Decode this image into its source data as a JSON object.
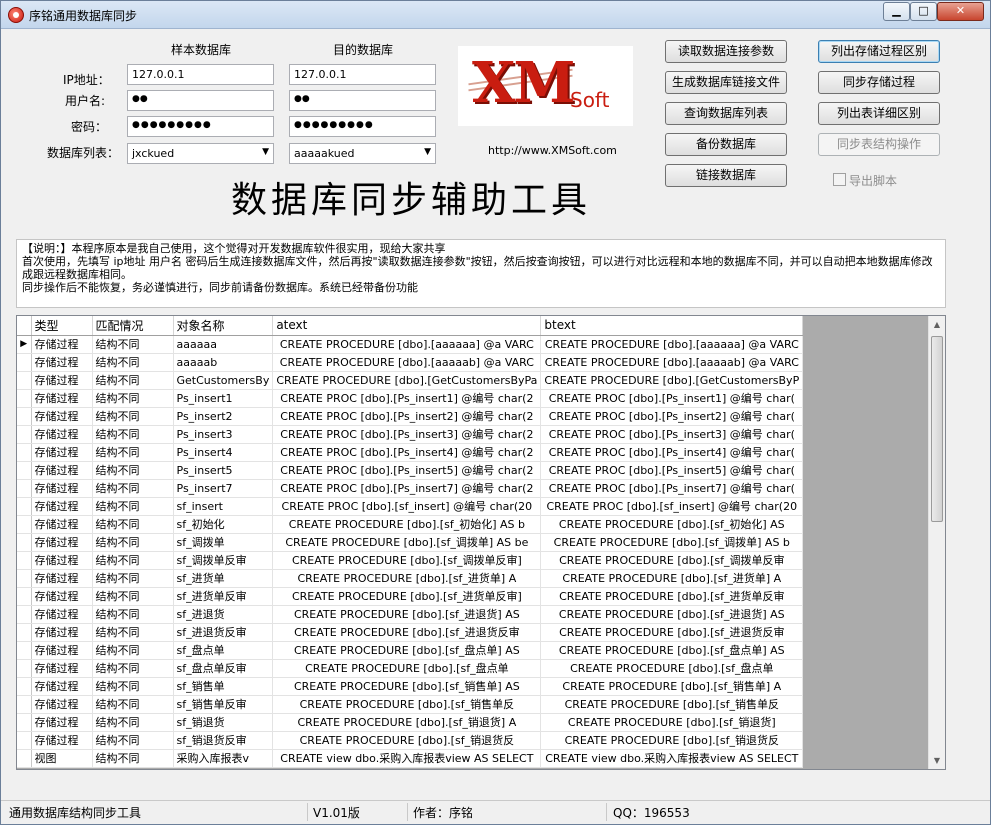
{
  "window": {
    "title": "序铭通用数据库同步"
  },
  "form": {
    "source_header": "样本数据库",
    "target_header": "目的数据库",
    "ip_label": "IP地址：",
    "user_label": "用户名:",
    "password_label": "密码：",
    "db_list_label": "数据库列表：",
    "source": {
      "ip": "127.0.0.1",
      "user": "●●",
      "password": "●●●●●●●●●",
      "database": "jxckued"
    },
    "target": {
      "ip": "127.0.0.1",
      "user": "●●",
      "password": "●●●●●●●●●",
      "database": "aaaaakued"
    }
  },
  "logo": {
    "brand": "XM",
    "suffix": "Soft",
    "url": "http://www.XMSoft.com"
  },
  "buttons": {
    "read_conn_params": "读取数据连接参数",
    "gen_conn_file": "生成数据库链接文件",
    "query_db_list": "查询数据库列表",
    "backup_db": "备份数据库",
    "connect_db": "链接数据库",
    "list_sp_diff": "列出存储过程区别",
    "sync_sp": "同步存储过程",
    "list_table_diff": "列出表详细区别",
    "sync_table_struct": "同步表结构操作",
    "export_script": "导出脚本"
  },
  "main_title": "数据库同步辅助工具",
  "description": {
    "line1": "【说明：】本程序原本是我自己使用，这个觉得对开发数据库软件很实用，现给大家共享",
    "line2": "首次使用，先填写 ip地址 用户名 密码后生成连接数据库文件，然后再按\"读取数据连接参数\"按钮，然后按查询按钮，可以进行对比远程和本地的数据库不同，并可以自动把本地数据库修改成跟远程数据库相同。",
    "line3": "同步操作后不能恢复，务必谨慎进行，同步前请备份数据库。系统已经带备份功能"
  },
  "grid": {
    "columns": [
      "类型",
      "匹配情况",
      "对象名称",
      "atext",
      "btext"
    ],
    "rows": [
      [
        "存储过程",
        "结构不同",
        "aaaaaa",
        "CREATE PROCEDURE  [dbo].[aaaaaa] @a VARC",
        "CREATE PROCEDURE  [dbo].[aaaaaa] @a VARC"
      ],
      [
        "存储过程",
        "结构不同",
        "aaaaab",
        "CREATE PROCEDURE  [dbo].[aaaaab] @a VARC",
        "CREATE PROCEDURE  [dbo].[aaaaab] @a VARC"
      ],
      [
        "存储过程",
        "结构不同",
        "GetCustomersBy",
        "CREATE PROCEDURE  [dbo].[GetCustomersByPa",
        "CREATE PROCEDURE  [dbo].[GetCustomersByP"
      ],
      [
        "存储过程",
        "结构不同",
        "Ps_insert1",
        "CREATE PROC [dbo].[Ps_insert1] @编号 char(2",
        "CREATE PROC [dbo].[Ps_insert1] @编号 char("
      ],
      [
        "存储过程",
        "结构不同",
        "Ps_insert2",
        "CREATE PROC [dbo].[Ps_insert2] @编号 char(2",
        "CREATE PROC [dbo].[Ps_insert2] @编号 char("
      ],
      [
        "存储过程",
        "结构不同",
        "Ps_insert3",
        "CREATE PROC [dbo].[Ps_insert3] @编号 char(2",
        "CREATE PROC [dbo].[Ps_insert3] @编号 char("
      ],
      [
        "存储过程",
        "结构不同",
        "Ps_insert4",
        "CREATE PROC [dbo].[Ps_insert4] @编号 char(2",
        "CREATE PROC [dbo].[Ps_insert4] @编号 char("
      ],
      [
        "存储过程",
        "结构不同",
        "Ps_insert5",
        "CREATE PROC [dbo].[Ps_insert5] @编号 char(2",
        "CREATE PROC [dbo].[Ps_insert5] @编号 char("
      ],
      [
        "存储过程",
        "结构不同",
        "Ps_insert7",
        "CREATE PROC [dbo].[Ps_insert7] @编号 char(2",
        "CREATE PROC [dbo].[Ps_insert7] @编号 char("
      ],
      [
        "存储过程",
        "结构不同",
        "sf_insert",
        "CREATE PROC [dbo].[sf_insert] @编号 char(20",
        "CREATE PROC [dbo].[sf_insert] @编号 char(20"
      ],
      [
        "存储过程",
        "结构不同",
        "sf_初始化",
        "CREATE PROCEDURE [dbo].[sf_初始化] AS b",
        "CREATE PROCEDURE [dbo].[sf_初始化] AS"
      ],
      [
        "存储过程",
        "结构不同",
        "sf_调拨单",
        "CREATE PROCEDURE [dbo].[sf_调拨单] AS be",
        "CREATE PROCEDURE [dbo].[sf_调拨单] AS b"
      ],
      [
        "存储过程",
        "结构不同",
        "sf_调拨单反审",
        "CREATE PROCEDURE [dbo].[sf_调拨单反审]",
        "CREATE PROCEDURE [dbo].[sf_调拨单反审"
      ],
      [
        "存储过程",
        "结构不同",
        "sf_进货单",
        "CREATE PROCEDURE [dbo].[sf_进货单] A",
        "CREATE PROCEDURE [dbo].[sf_进货单] A"
      ],
      [
        "存储过程",
        "结构不同",
        "sf_进货单反审",
        "CREATE PROCEDURE [dbo].[sf_进货单反审]",
        "CREATE PROCEDURE [dbo].[sf_进货单反审"
      ],
      [
        "存储过程",
        "结构不同",
        "sf_进退货",
        "CREATE PROCEDURE [dbo].[sf_进退货] AS",
        "CREATE PROCEDURE [dbo].[sf_进退货] AS"
      ],
      [
        "存储过程",
        "结构不同",
        "sf_进退货反审",
        "CREATE PROCEDURE [dbo].[sf_进退货反审",
        "CREATE PROCEDURE [dbo].[sf_进退货反审"
      ],
      [
        "存储过程",
        "结构不同",
        "sf_盘点单",
        "CREATE PROCEDURE [dbo].[sf_盘点单] AS",
        "CREATE PROCEDURE [dbo].[sf_盘点单] AS"
      ],
      [
        "存储过程",
        "结构不同",
        "sf_盘点单反审",
        "CREATE PROCEDURE [dbo].[sf_盘点单",
        "CREATE PROCEDURE [dbo].[sf_盘点单"
      ],
      [
        "存储过程",
        "结构不同",
        "sf_销售单",
        "CREATE PROCEDURE [dbo].[sf_销售单] AS",
        "CREATE PROCEDURE [dbo].[sf_销售单] A"
      ],
      [
        "存储过程",
        "结构不同",
        "sf_销售单反审",
        "CREATE PROCEDURE [dbo].[sf_销售单反",
        "CREATE PROCEDURE [dbo].[sf_销售单反"
      ],
      [
        "存储过程",
        "结构不同",
        "sf_销退货",
        "CREATE PROCEDURE [dbo].[sf_销退货] A",
        "CREATE PROCEDURE [dbo].[sf_销退货]"
      ],
      [
        "存储过程",
        "结构不同",
        "sf_销退货反审",
        "CREATE PROCEDURE [dbo].[sf_销退货反",
        "CREATE PROCEDURE [dbo].[sf_销退货反"
      ],
      [
        "视图",
        "结构不同",
        "采购入库报表v",
        "CREATE view dbo.采购入库报表view AS SELECT",
        "CREATE view dbo.采购入库报表view AS SELECT"
      ]
    ]
  },
  "status": {
    "app_name": "通用数据库结构同步工具",
    "version": "V1.01版",
    "author": "作者：序铭",
    "qq": "QQ：196553"
  },
  "colors": {
    "logo_red": "#c91d10",
    "window_bg": "#f0f0f0"
  }
}
